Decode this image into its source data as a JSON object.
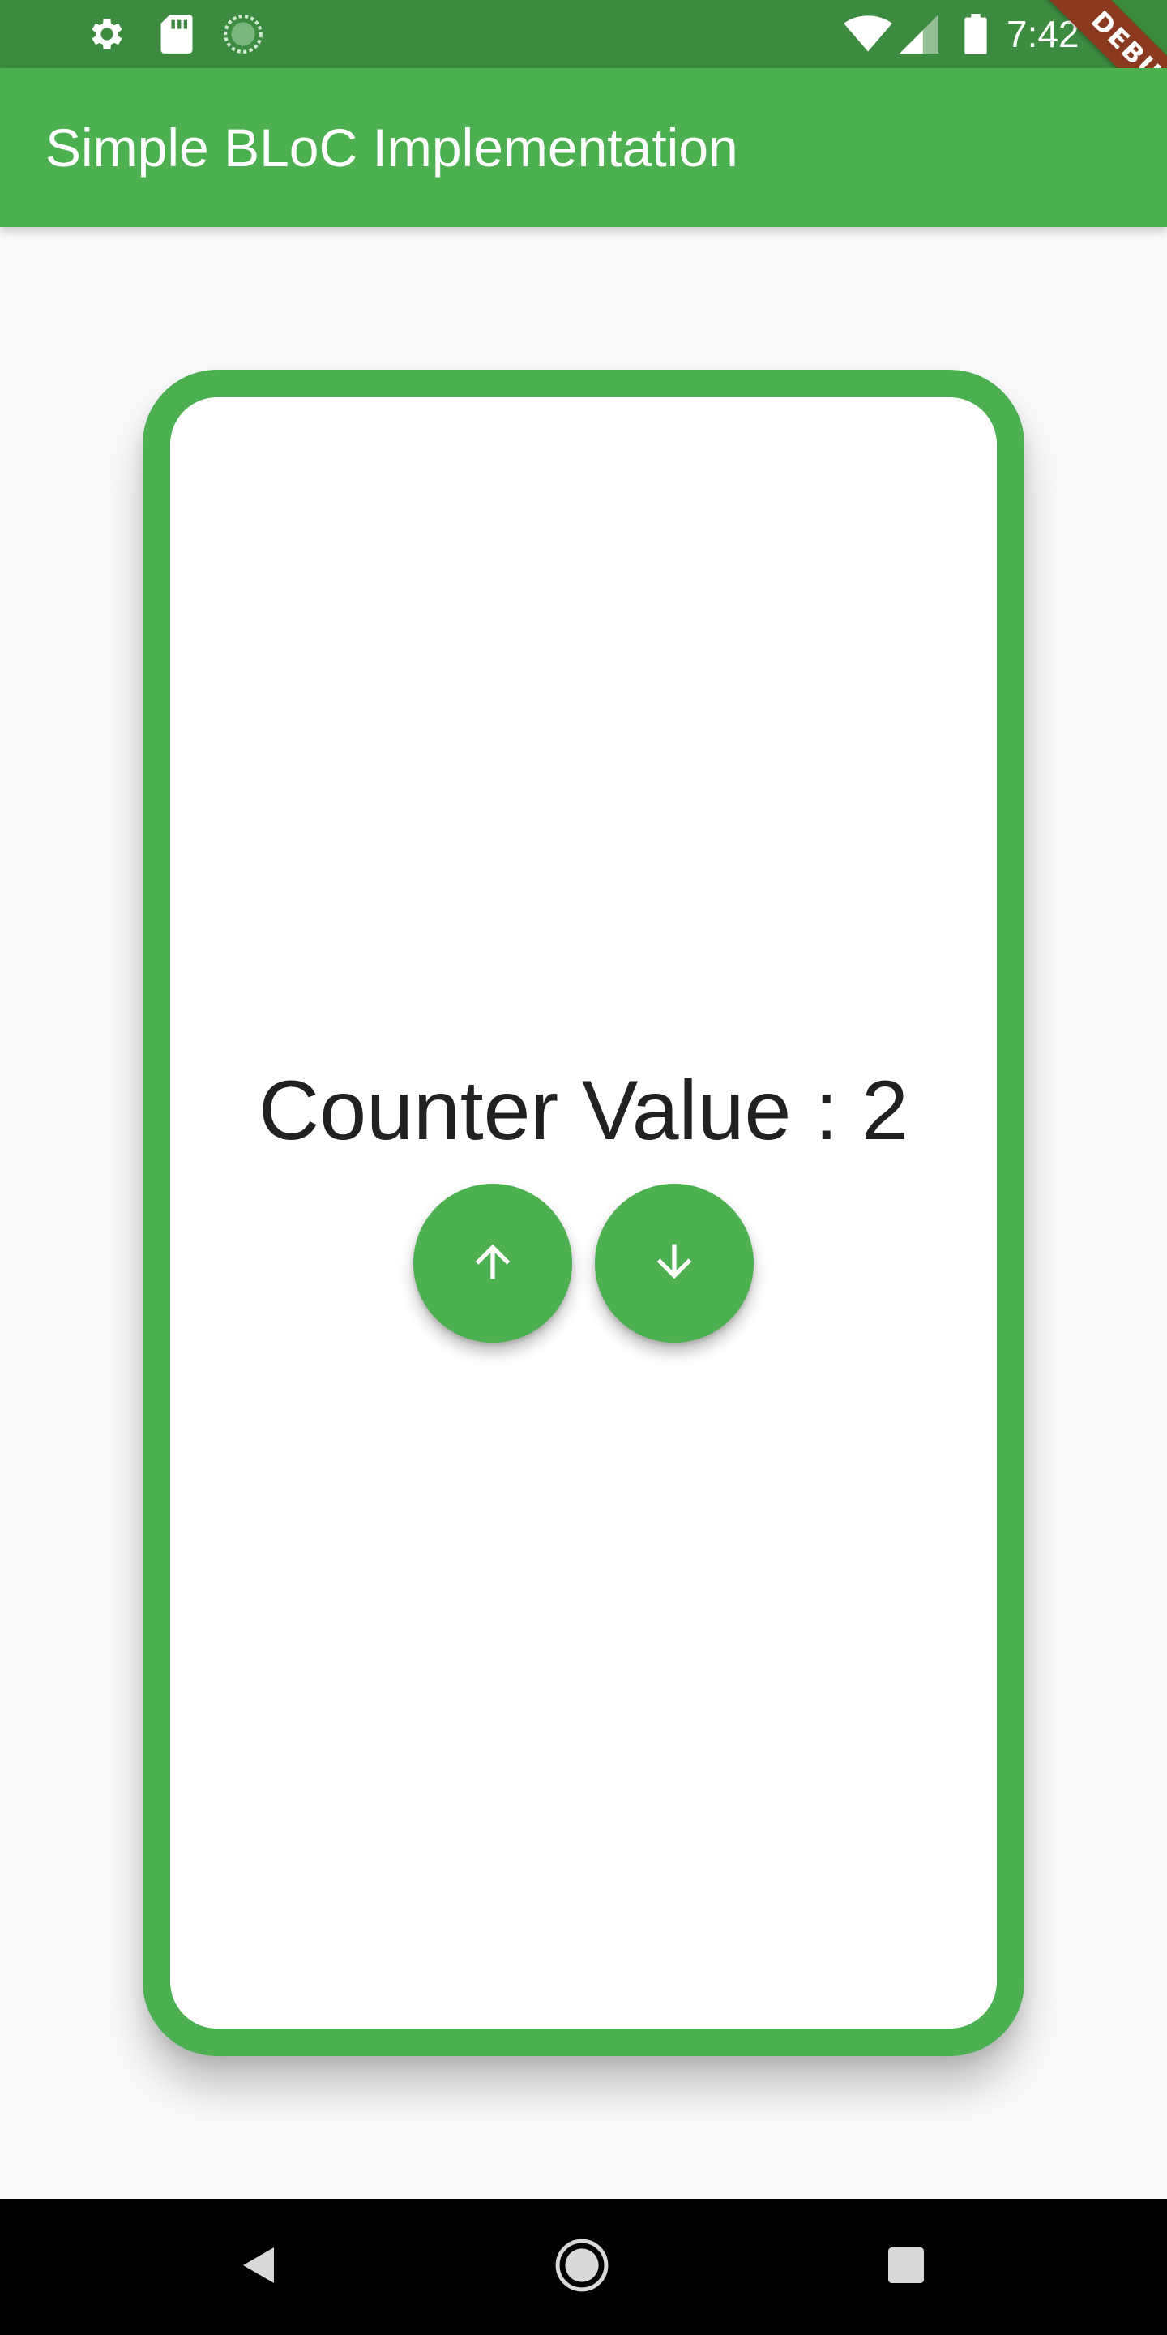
{
  "status_bar": {
    "time": "7:42",
    "left_icons": [
      "gear-icon",
      "sd-card-icon",
      "sync-icon"
    ],
    "right_icons": [
      "wifi-icon",
      "cell-signal-icon",
      "battery-icon"
    ],
    "background_color": "#3d8b40"
  },
  "debug_banner": {
    "label": "DEBUG",
    "color": "#8a3a1e"
  },
  "app_bar": {
    "title": "Simple BLoC Implementation",
    "color": "#4caf50"
  },
  "counter": {
    "label": "Counter Value : 2",
    "value": 2
  },
  "buttons": {
    "increment_icon": "arrow-up-icon",
    "decrement_icon": "arrow-down-icon",
    "color": "#4caf50"
  },
  "nav_bar": {
    "icons": [
      "back-icon",
      "home-icon",
      "recents-icon"
    ]
  }
}
